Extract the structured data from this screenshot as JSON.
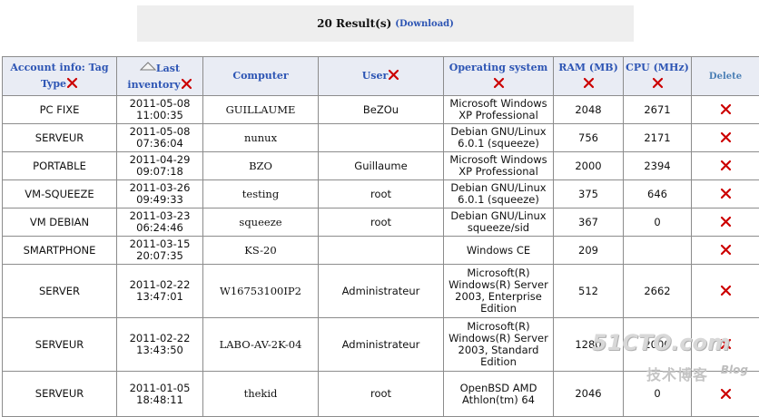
{
  "header": {
    "result_count": "20 Result(s)",
    "download_label": "(Download)"
  },
  "columns": [
    {
      "label": "Account info: Tag Type",
      "removable": true
    },
    {
      "label": "Last inventory",
      "removable": true,
      "sorted": "ascending"
    },
    {
      "label": "Computer",
      "removable": false
    },
    {
      "label": "User",
      "removable": true
    },
    {
      "label": "Operating system",
      "removable": true
    },
    {
      "label": "RAM (MB)",
      "removable": true
    },
    {
      "label": "CPU (MHz)",
      "removable": true
    },
    {
      "label": "Delete",
      "removable": false
    }
  ],
  "rows": [
    {
      "tag": "PC FIXE",
      "date": "2011-05-08",
      "time": "11:00:35",
      "computer": "GUILLAUME",
      "user": "BeZOu",
      "os": [
        "Microsoft Windows",
        "XP Professional"
      ],
      "ram": "2048",
      "cpu": "2671"
    },
    {
      "tag": "SERVEUR",
      "date": "2011-05-08",
      "time": "07:36:04",
      "computer": "nunux",
      "user": "",
      "os": [
        "Debian GNU/Linux",
        "6.0.1 (squeeze)"
      ],
      "ram": "756",
      "cpu": "2171"
    },
    {
      "tag": "PORTABLE",
      "date": "2011-04-29",
      "time": "09:07:18",
      "computer": "BZO",
      "user": "Guillaume",
      "os": [
        "Microsoft Windows",
        "XP Professional"
      ],
      "ram": "2000",
      "cpu": "2394"
    },
    {
      "tag": "VM-SQUEEZE",
      "date": "2011-03-26",
      "time": "09:49:33",
      "computer": "testing",
      "user": "root",
      "os": [
        "Debian GNU/Linux",
        "6.0.1 (squeeze)"
      ],
      "ram": "375",
      "cpu": "646"
    },
    {
      "tag": "VM DEBIAN",
      "date": "2011-03-23",
      "time": "06:24:46",
      "computer": "squeeze",
      "user": "root",
      "os": [
        "Debian GNU/Linux",
        "squeeze/sid"
      ],
      "ram": "367",
      "cpu": "0"
    },
    {
      "tag": "SMARTPHONE",
      "date": "2011-03-15",
      "time": "20:07:35",
      "computer": "KS-20",
      "user": "",
      "os": [
        "Windows CE"
      ],
      "ram": "209",
      "cpu": ""
    },
    {
      "tag": "SERVER",
      "date": "2011-02-22",
      "time": "13:47:01",
      "computer": "W16753100IP2",
      "user": "Administrateur",
      "os": [
        "Microsoft(R)",
        "Windows(R) Server",
        "2003, Enterprise",
        "Edition"
      ],
      "ram": "512",
      "cpu": "2662"
    },
    {
      "tag": "SERVEUR",
      "date": "2011-02-22",
      "time": "13:43:50",
      "computer": "LABO-AV-2K-04",
      "user": "Administrateur",
      "os": [
        "Microsoft(R)",
        "Windows(R) Server",
        "2003, Standard",
        "Edition"
      ],
      "ram": "1280",
      "cpu": "2000"
    },
    {
      "tag": "SERVEUR",
      "date": "2011-01-05",
      "time": "18:48:11",
      "computer": "thekid",
      "user": "root",
      "os": [
        "OpenBSD AMD",
        "Athlon(tm) 64"
      ],
      "ram": "2046",
      "cpu": "0"
    }
  ],
  "watermark": {
    "brand": "51CTO.com",
    "subtitle": "技术博客",
    "blog": "Blog"
  },
  "colors": {
    "link": "#2d55b4",
    "header_bg": "#e9ecf4",
    "delete_icon": "#cc0000",
    "result_box_bg": "#eeeeee"
  }
}
